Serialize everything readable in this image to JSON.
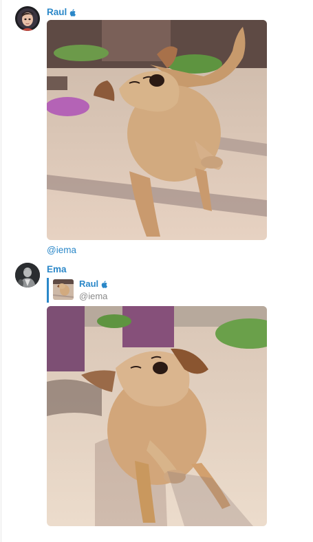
{
  "messages": [
    {
      "sender": "Raul",
      "sender_badge_icon": "apple-icon",
      "avatar_icon": "cartoon-avatar",
      "attachment": "photo",
      "caption": "@iema"
    },
    {
      "sender": "Ema",
      "avatar_icon": "dark-figure-avatar",
      "reply_to": {
        "sender": "Raul",
        "sender_badge_icon": "apple-icon",
        "text": "@iema"
      },
      "attachment": "photo"
    }
  ],
  "colors": {
    "accent": "#2a87c8",
    "muted_text": "#8a8a8a",
    "background": "#ffffff"
  }
}
